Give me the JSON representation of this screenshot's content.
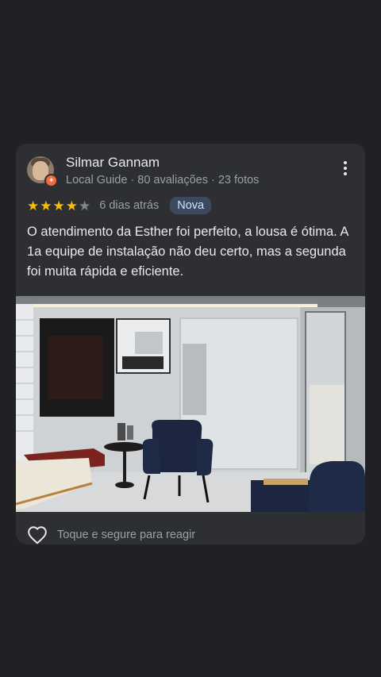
{
  "review": {
    "author": "Silmar Gannam",
    "meta": "Local Guide · 80 avaliações · 23 fotos",
    "rating": 4,
    "max_rating": 5,
    "time": "6 dias atrás",
    "badge": "Nova",
    "text": "O atendimento da Esther foi perfeito, a lousa é ótima. A 1a equipe de instalação não deu certo, mas a segunda foi muita rápida e eficiente."
  },
  "reaction": {
    "label": "Toque e segure para reagir",
    "icon": "heart-icon"
  },
  "colors": {
    "background": "#202124",
    "card": "#2e2f32",
    "star": "#fbbc04",
    "badge_bg": "#3c4a60"
  }
}
